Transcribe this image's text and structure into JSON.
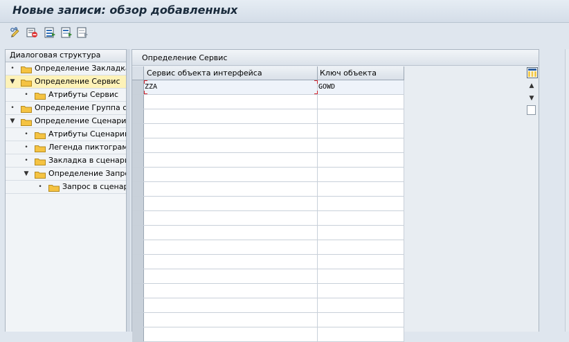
{
  "title": "Новые записи: обзор добавленных",
  "toolbar": {
    "icons": [
      "display-change-icon",
      "delete-icon",
      "select-all-icon",
      "select-block-icon",
      "deselect-all-icon"
    ]
  },
  "dialog_structure": {
    "header": "Диалоговая структура",
    "items": [
      {
        "label": "Определение Закладка",
        "marker": "•",
        "level": 0,
        "selected": false
      },
      {
        "label": "Определение Сервис",
        "marker": "▼",
        "level": 0,
        "selected": true
      },
      {
        "label": "Атрибуты Сервис",
        "marker": "•",
        "level": 1,
        "selected": false
      },
      {
        "label": "Определение Группа с",
        "marker": "•",
        "level": 0,
        "selected": false
      },
      {
        "label": "Определение Сценари",
        "marker": "▼",
        "level": 0,
        "selected": false
      },
      {
        "label": "Атрибуты Сценарий",
        "marker": "•",
        "level": 1,
        "selected": false
      },
      {
        "label": "Легенда пиктограмм",
        "marker": "•",
        "level": 1,
        "selected": false
      },
      {
        "label": "Закладка в сценарии",
        "marker": "•",
        "level": 1,
        "selected": false
      },
      {
        "label": "Определение Запрос",
        "marker": "▼",
        "level": 1,
        "selected": false
      },
      {
        "label": "Запрос в сценар",
        "marker": "•",
        "level": 2,
        "selected": false
      }
    ]
  },
  "panel": {
    "title": "Определение Сервис",
    "columns": [
      "Сервис объекта интерфейса",
      "Ключ объекта"
    ],
    "rows": [
      [
        "ZZA",
        "GOWD"
      ],
      [
        "",
        ""
      ],
      [
        "",
        ""
      ],
      [
        "",
        ""
      ],
      [
        "",
        ""
      ],
      [
        "",
        ""
      ],
      [
        "",
        ""
      ],
      [
        "",
        ""
      ],
      [
        "",
        ""
      ],
      [
        "",
        ""
      ],
      [
        "",
        ""
      ],
      [
        "",
        ""
      ],
      [
        "",
        ""
      ],
      [
        "",
        ""
      ],
      [
        "",
        ""
      ],
      [
        "",
        ""
      ],
      [
        "",
        ""
      ],
      [
        "",
        ""
      ]
    ]
  },
  "colors": {
    "folder": "#f5c342",
    "selected_node": "#fdf2b8",
    "focus_marker": "#d0202a"
  }
}
